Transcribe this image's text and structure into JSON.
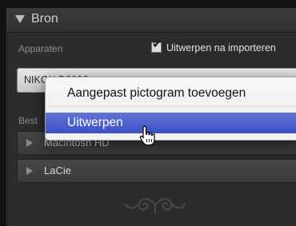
{
  "panel": {
    "title": "Bron",
    "devices_label": "Apparaten",
    "eject_after_import": {
      "label": "Uitwerpen na importeren",
      "checked": true
    },
    "selected_device": "NIKON D300S",
    "destination_label_partial": "Best",
    "folders": [
      {
        "label": "Macintosh HD"
      },
      {
        "label": "LaCie"
      }
    ]
  },
  "context_menu": {
    "items": [
      {
        "label": "Aangepast pictogram toevoegen",
        "highlighted": false
      },
      {
        "label": "Uitwerpen",
        "highlighted": true
      }
    ]
  },
  "icons": {
    "collapse": "triangle-down-icon",
    "expand": "triangle-right-icon",
    "check": "checkmark-icon",
    "cursor": "hand-pointer-cursor-icon",
    "ornament": "decorative-scroll-icon"
  },
  "colors": {
    "panel_bg": "#2c2c2c",
    "menu_bg": "#f6f6f6",
    "highlight": "#4a5ccd"
  }
}
